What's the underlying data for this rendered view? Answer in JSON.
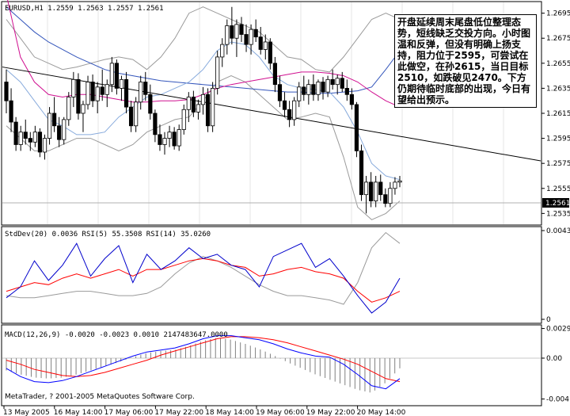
{
  "main_panel": {
    "header": "EURUSD,H1  1.2559 1.2563 1.2557 1.2561",
    "y_ticks": [
      "1.2695",
      "1.2675",
      "1.2655",
      "1.2635",
      "1.2615",
      "1.2595",
      "1.2575",
      "1.2555",
      "1.2535"
    ],
    "last_price": "1.2561",
    "annotation": "开盘延续周末尾盘低位整理态势，短线缺乏交投方向。小时图温和反弹，但没有明确上扬支持，阻力位于2595，可尝试在此做空，在孙2615，当日目标2510，如跌破见2470。下方仍期待临时底部的出现，今日有望给出预示。"
  },
  "stddev_panel": {
    "header": "StdDev(20) 0.0036  RSI(5) 55.3508  RSI(14) 35.0260",
    "y_ticks": [
      "0.0043",
      "0"
    ]
  },
  "macd_panel": {
    "header": "MACD(12,26,9) -0.0020 -0.0023 0.0010 2147483647.0000",
    "y_ticks": [
      "0.0029",
      "0.00",
      "-0.004"
    ],
    "copyright": "MetaTrader, ? 2001-2005 MetaQuotes Software Corp."
  },
  "x_ticks": [
    "13 May 2005",
    "16 May 14:00",
    "17 May 06:00",
    "17 May 22:00",
    "18 May 14:00",
    "19 May 06:00",
    "19 May 22:00",
    "20 May 14:00"
  ],
  "colors": {
    "bull": "#ffffff",
    "bear": "#000000",
    "ma_fast": "#87aadc",
    "ma_slow": "#3355bb",
    "ma_pink": "#d01090",
    "bands": "#9a9a9a",
    "rsi5": "#0000cc",
    "rsi14": "#ff0000",
    "stddev": "#9a9a9a",
    "macd_main": "#0000ff",
    "macd_signal": "#ff0000",
    "macd_hist": "#808080"
  },
  "chart_data": [
    {
      "type": "candlestick",
      "title": "EURUSD,H1",
      "ylim": [
        1.2527,
        1.2703
      ],
      "ohlc": [
        [
          1.264,
          1.265,
          1.2615,
          1.2625
        ],
        [
          1.2625,
          1.2635,
          1.26,
          1.2608
        ],
        [
          1.2608,
          1.2612,
          1.2585,
          1.259
        ],
        [
          1.259,
          1.2605,
          1.2585,
          1.26
        ],
        [
          1.26,
          1.261,
          1.259,
          1.2595
        ],
        [
          1.2595,
          1.26,
          1.2585,
          1.2592
        ],
        [
          1.2592,
          1.2605,
          1.2588,
          1.26
        ],
        [
          1.26,
          1.2603,
          1.258,
          1.2584
        ],
        [
          1.2584,
          1.2598,
          1.2578,
          1.2595
        ],
        [
          1.2595,
          1.262,
          1.259,
          1.2615
        ],
        [
          1.2615,
          1.2628,
          1.26,
          1.2605
        ],
        [
          1.2605,
          1.2612,
          1.2588,
          1.2594
        ],
        [
          1.2594,
          1.2612,
          1.259,
          1.261
        ],
        [
          1.261,
          1.2632,
          1.2605,
          1.2628
        ],
        [
          1.2628,
          1.2648,
          1.262,
          1.2642
        ],
        [
          1.2642,
          1.2647,
          1.261,
          1.2615
        ],
        [
          1.2615,
          1.2625,
          1.26,
          1.2622
        ],
        [
          1.2622,
          1.2645,
          1.2618,
          1.264
        ],
        [
          1.264,
          1.2646,
          1.262,
          1.2625
        ],
        [
          1.2625,
          1.264,
          1.2615,
          1.2636
        ],
        [
          1.2636,
          1.265,
          1.2625,
          1.263
        ],
        [
          1.263,
          1.2642,
          1.262,
          1.2638
        ],
        [
          1.2638,
          1.266,
          1.2632,
          1.2655
        ],
        [
          1.2655,
          1.2658,
          1.263,
          1.2635
        ],
        [
          1.2635,
          1.2645,
          1.2625,
          1.2642
        ],
        [
          1.2642,
          1.2648,
          1.2615,
          1.262
        ],
        [
          1.262,
          1.2625,
          1.26,
          1.2605
        ],
        [
          1.2605,
          1.2628,
          1.26,
          1.2624
        ],
        [
          1.2624,
          1.2645,
          1.2618,
          1.264
        ],
        [
          1.264,
          1.2648,
          1.2625,
          1.263
        ],
        [
          1.263,
          1.2638,
          1.261,
          1.2615
        ],
        [
          1.2615,
          1.2618,
          1.2592,
          1.2598
        ],
        [
          1.2598,
          1.2606,
          1.2585,
          1.259
        ],
        [
          1.259,
          1.26,
          1.2582,
          1.2595
        ],
        [
          1.2595,
          1.2605,
          1.2588,
          1.26
        ],
        [
          1.26,
          1.2604,
          1.2586,
          1.2589
        ],
        [
          1.2589,
          1.2606,
          1.2585,
          1.2602
        ],
        [
          1.2602,
          1.2622,
          1.2598,
          1.2618
        ],
        [
          1.2618,
          1.2632,
          1.2608,
          1.2628
        ],
        [
          1.2628,
          1.2633,
          1.2612,
          1.2616
        ],
        [
          1.2616,
          1.2626,
          1.261,
          1.2622
        ],
        [
          1.2622,
          1.2636,
          1.2614,
          1.263
        ],
        [
          1.263,
          1.2635,
          1.26,
          1.2605
        ],
        [
          1.2605,
          1.264,
          1.26,
          1.2635
        ],
        [
          1.2635,
          1.2665,
          1.263,
          1.266
        ],
        [
          1.266,
          1.2675,
          1.2652,
          1.267
        ],
        [
          1.267,
          1.269,
          1.2662,
          1.2685
        ],
        [
          1.2685,
          1.27,
          1.267,
          1.2675
        ],
        [
          1.2675,
          1.269,
          1.266,
          1.2686
        ],
        [
          1.2686,
          1.2692,
          1.2672,
          1.2678
        ],
        [
          1.2678,
          1.2686,
          1.2664,
          1.267
        ],
        [
          1.267,
          1.2686,
          1.2662,
          1.2682
        ],
        [
          1.2682,
          1.269,
          1.2672,
          1.2676
        ],
        [
          1.2676,
          1.2684,
          1.2662,
          1.2666
        ],
        [
          1.2666,
          1.2678,
          1.2658,
          1.2672
        ],
        [
          1.2672,
          1.2675,
          1.265,
          1.2655
        ],
        [
          1.2655,
          1.266,
          1.2632,
          1.2638
        ],
        [
          1.2638,
          1.2645,
          1.262,
          1.2625
        ],
        [
          1.2625,
          1.2632,
          1.2612,
          1.2618
        ],
        [
          1.2618,
          1.2625,
          1.2604,
          1.261
        ],
        [
          1.261,
          1.2628,
          1.2605,
          1.2625
        ],
        [
          1.2625,
          1.264,
          1.262,
          1.2636
        ],
        [
          1.2636,
          1.2645,
          1.2625,
          1.263
        ],
        [
          1.263,
          1.2642,
          1.2622,
          1.2638
        ],
        [
          1.2638,
          1.2646,
          1.2625,
          1.263
        ],
        [
          1.263,
          1.2642,
          1.2625,
          1.264
        ],
        [
          1.264,
          1.2644,
          1.2626,
          1.2632
        ],
        [
          1.2632,
          1.2645,
          1.2628,
          1.2642
        ],
        [
          1.2642,
          1.265,
          1.2634,
          1.2638
        ],
        [
          1.2638,
          1.2646,
          1.263,
          1.2643
        ],
        [
          1.2643,
          1.2648,
          1.2632,
          1.2635
        ],
        [
          1.2635,
          1.2642,
          1.2625,
          1.263
        ],
        [
          1.263,
          1.2635,
          1.2618,
          1.2622
        ],
        [
          1.2622,
          1.2624,
          1.258,
          1.2585
        ],
        [
          1.2585,
          1.259,
          1.2545,
          1.255
        ],
        [
          1.255,
          1.2565,
          1.2535,
          1.256
        ],
        [
          1.256,
          1.2568,
          1.254,
          1.2545
        ],
        [
          1.2545,
          1.2565,
          1.254,
          1.256
        ],
        [
          1.256,
          1.2566,
          1.2545,
          1.255
        ],
        [
          1.255,
          1.2555,
          1.254,
          1.2543
        ],
        [
          1.2543,
          1.256,
          1.254,
          1.2555
        ],
        [
          1.2555,
          1.2564,
          1.255,
          1.256
        ],
        [
          1.256,
          1.2565,
          1.2556,
          1.2561
        ]
      ],
      "trendline": {
        "start": 1.2652,
        "end": 1.2577
      },
      "ma_fast": [
        1.265,
        1.264,
        1.2625,
        1.261,
        1.2605,
        1.2598,
        1.2598,
        1.26,
        1.2612,
        1.262,
        1.2628,
        1.263,
        1.2635,
        1.264,
        1.265,
        1.2665,
        1.2672,
        1.267,
        1.266,
        1.2645,
        1.2638,
        1.2635,
        1.2634,
        1.2632,
        1.262,
        1.26,
        1.2575,
        1.2565,
        1.2562
      ],
      "ma_slow": [
        1.27,
        1.269,
        1.268,
        1.2672,
        1.2666,
        1.266,
        1.2655,
        1.265,
        1.2647,
        1.2645,
        1.2643,
        1.2641,
        1.264,
        1.2639,
        1.2638,
        1.2637,
        1.2636,
        1.2635,
        1.2634,
        1.2633,
        1.2632,
        1.2632,
        1.2631,
        1.2631,
        1.2632,
        1.2633,
        1.2636,
        1.265,
        1.2665
      ],
      "ma_pink": [
        1.271,
        1.266,
        1.264,
        1.263,
        1.2628,
        1.263,
        1.263,
        1.2628,
        1.2626,
        1.2624,
        1.2624,
        1.2625,
        1.2625,
        1.2626,
        1.263,
        1.2635,
        1.2638,
        1.264,
        1.2642,
        1.2644,
        1.2646,
        1.2648,
        1.2648,
        1.2647,
        1.2645,
        1.264,
        1.2632,
        1.2625,
        1.262
      ],
      "band_upper": [
        1.269,
        1.2675,
        1.266,
        1.2655,
        1.265,
        1.2652,
        1.2655,
        1.2658,
        1.266,
        1.2658,
        1.265,
        1.266,
        1.2675,
        1.2695,
        1.27,
        1.2695,
        1.269,
        1.2685,
        1.268,
        1.267,
        1.266,
        1.2658,
        1.265,
        1.2648,
        1.266,
        1.2675,
        1.269,
        1.2695,
        1.269
      ],
      "band_lower": [
        1.2605,
        1.2595,
        1.2585,
        1.2585,
        1.259,
        1.2595,
        1.2595,
        1.259,
        1.2585,
        1.259,
        1.26,
        1.2605,
        1.261,
        1.2612,
        1.2625,
        1.264,
        1.2645,
        1.264,
        1.263,
        1.262,
        1.261,
        1.2612,
        1.2615,
        1.2612,
        1.258,
        1.254,
        1.253,
        1.2535,
        1.2545
      ]
    },
    {
      "type": "line",
      "title": "StdDev(20) 0.0036  RSI(5) 55.3508  RSI(14) 35.0260",
      "ylim": [
        0,
        0.0043
      ],
      "series": [
        {
          "name": "RSI(5)",
          "values": [
            0.0011,
            0.0016,
            0.0028,
            0.0019,
            0.0026,
            0.0036,
            0.0021,
            0.0029,
            0.0035,
            0.0018,
            0.0031,
            0.0024,
            0.0028,
            0.0034,
            0.0029,
            0.0031,
            0.0026,
            0.0024,
            0.0016,
            0.003,
            0.0033,
            0.0036,
            0.0025,
            0.0029,
            0.0021,
            0.0012,
            0.0004,
            0.0009,
            0.002
          ]
        },
        {
          "name": "RSI(14)",
          "values": [
            0.0014,
            0.0016,
            0.0018,
            0.0017,
            0.002,
            0.0022,
            0.002,
            0.0022,
            0.0024,
            0.0021,
            0.0024,
            0.0024,
            0.0026,
            0.0028,
            0.0029,
            0.0028,
            0.0026,
            0.0025,
            0.0021,
            0.0022,
            0.0024,
            0.0025,
            0.0023,
            0.0022,
            0.002,
            0.0014,
            0.0009,
            0.0011,
            0.0014
          ]
        },
        {
          "name": "StdDev(20)",
          "values": [
            0.0012,
            0.0011,
            0.0011,
            0.0012,
            0.0013,
            0.0014,
            0.0014,
            0.0013,
            0.0012,
            0.0012,
            0.0013,
            0.0016,
            0.0022,
            0.0027,
            0.003,
            0.0028,
            0.0025,
            0.0021,
            0.0017,
            0.0014,
            0.0012,
            0.0012,
            0.0011,
            0.001,
            0.0008,
            0.0018,
            0.0034,
            0.0041,
            0.0036
          ]
        }
      ]
    },
    {
      "type": "line",
      "title": "MACD(12,26,9) -0.0020 -0.0023 0.0010 2147483647.0000",
      "ylim": [
        -0.0045,
        0.0031
      ],
      "series": [
        {
          "name": "histogram",
          "values": [
            -0.0012,
            -0.0016,
            -0.0019,
            -0.002,
            -0.0019,
            -0.0016,
            -0.0012,
            -0.0008,
            -0.0004,
            0.0001,
            0.0005,
            0.0007,
            0.0008,
            0.0012,
            0.0017,
            0.002,
            0.0018,
            0.0014,
            0.0009,
            0.0003,
            -0.0004,
            -0.001,
            -0.0016,
            -0.0021,
            -0.0026,
            -0.0031,
            -0.0034,
            -0.0024,
            -0.001
          ]
        },
        {
          "name": "MACD(12,26,9)",
          "values": [
            -0.001,
            -0.0018,
            -0.0023,
            -0.0024,
            -0.0022,
            -0.0018,
            -0.0013,
            -0.0008,
            -0.0003,
            0.0002,
            0.0006,
            0.0008,
            0.001,
            0.0014,
            0.0019,
            0.0022,
            0.0022,
            0.002,
            0.0018,
            0.0014,
            0.0009,
            0.0005,
            0.0002,
            0.0001,
            -0.0006,
            -0.0016,
            -0.0027,
            -0.003,
            -0.002
          ]
        },
        {
          "name": "signal",
          "values": [
            -0.0002,
            -0.0006,
            -0.0011,
            -0.0014,
            -0.0017,
            -0.0018,
            -0.0017,
            -0.0014,
            -0.001,
            -0.0006,
            -0.0002,
            0.0003,
            0.0007,
            0.0011,
            0.0015,
            0.0019,
            0.0021,
            0.0021,
            0.002,
            0.0018,
            0.0015,
            0.0011,
            0.0007,
            0.0003,
            -0.0001,
            -0.0006,
            -0.0013,
            -0.002,
            -0.0023
          ]
        }
      ]
    }
  ]
}
